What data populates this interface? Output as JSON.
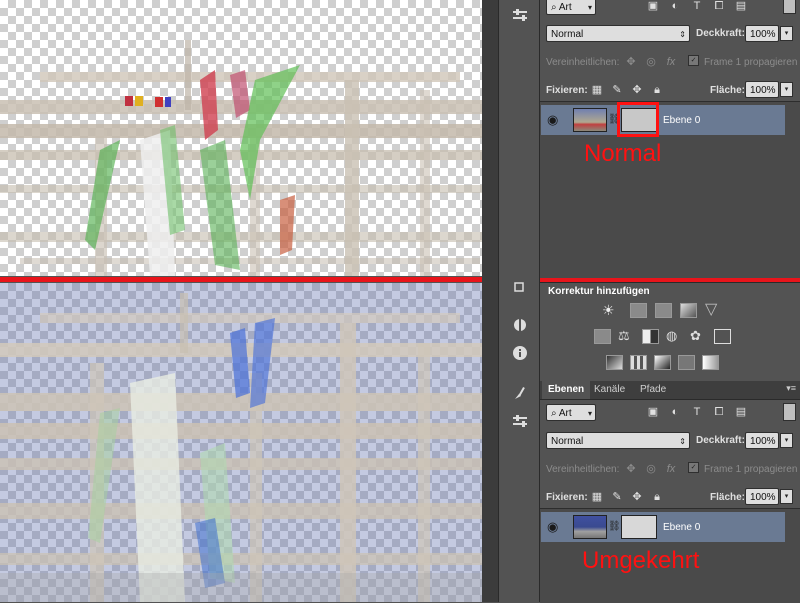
{
  "panel_top": {
    "filter_kind": "Art",
    "blend_mode": "Normal",
    "opacity_label": "Deckkraft:",
    "opacity_value": "100%",
    "unify_label": "Vereinheitlichen:",
    "propagate_label": "Frame 1 propagieren",
    "lock_label": "Fixieren:",
    "fill_label": "Fläche:",
    "fill_value": "100%",
    "layer_name": "Ebene 0",
    "annotation": "Normal"
  },
  "adjustments": {
    "title": "Korrektur hinzufügen"
  },
  "panel_bottom": {
    "tabs": [
      "Ebenen",
      "Kanäle",
      "Pfade"
    ],
    "filter_kind": "Art",
    "blend_mode": "Normal",
    "opacity_label": "Deckkraft:",
    "opacity_value": "100%",
    "unify_label": "Vereinheitlichen:",
    "propagate_label": "Frame 1 propagieren",
    "lock_label": "Fixieren:",
    "fill_label": "Fläche:",
    "fill_value": "100%",
    "layer_name": "Ebene 0",
    "annotation": "Umgekehrt"
  },
  "colors": {
    "annotation_red": "#ff1111",
    "panel_bg": "#535353",
    "layer_selected": "#6a7a93"
  },
  "icons": [
    "sliders-icon",
    "info-icon",
    "adjust-icon",
    "brush-icon",
    "eye-icon",
    "lock-icon",
    "move-icon",
    "link-icon"
  ]
}
